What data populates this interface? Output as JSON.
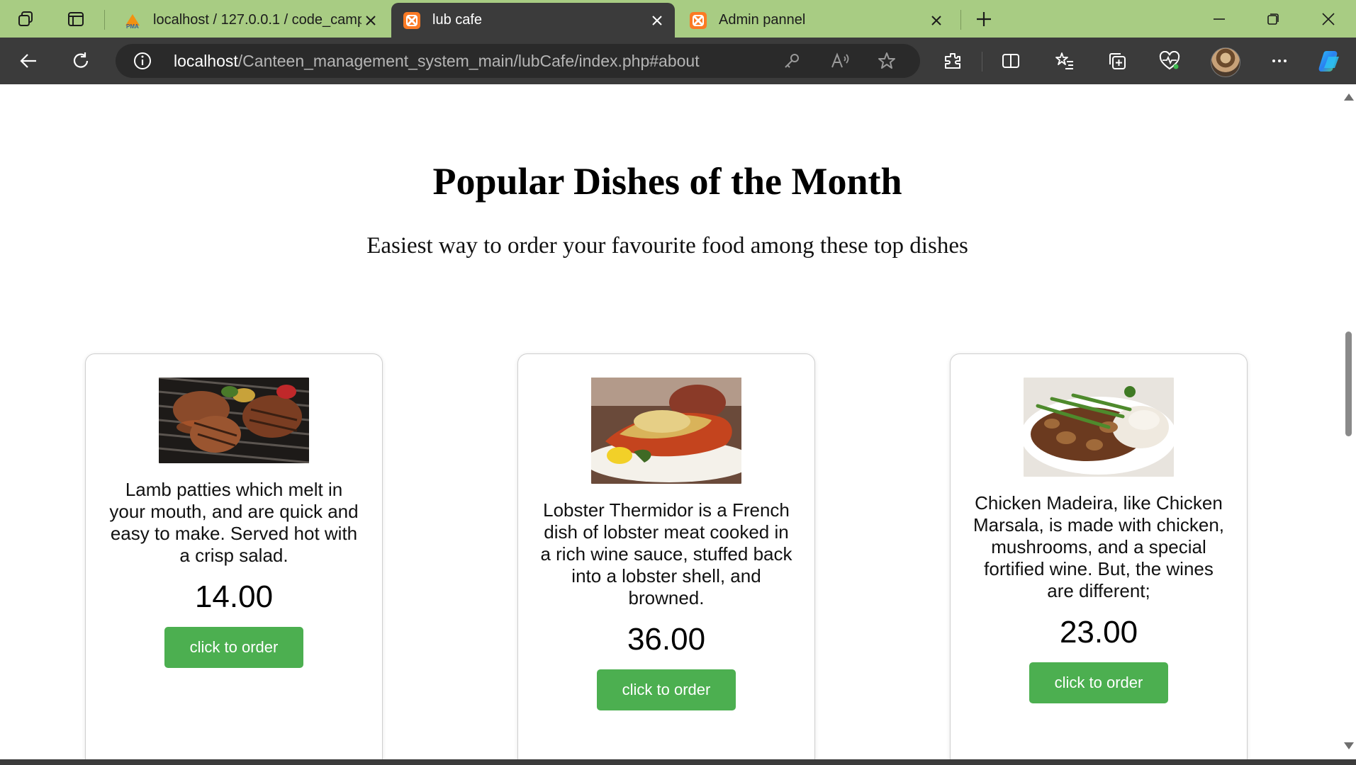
{
  "browser": {
    "tabs": [
      {
        "label": "localhost / 127.0.0.1 / code_camp",
        "favicon": "phpmyadmin-icon",
        "active": false
      },
      {
        "label": "lub cafe",
        "favicon": "xampp-icon",
        "active": true
      },
      {
        "label": "Admin pannel",
        "favicon": "xampp-icon",
        "active": false
      }
    ],
    "address": {
      "host": "localhost",
      "path": "/Canteen_management_system_main/lubCafe/index.php#about"
    },
    "accent_tab_strip": "#a8cc83",
    "toolbar_color": "#3b3b3b"
  },
  "page": {
    "title": "Popular Dishes of the Month",
    "subtitle": "Easiest way to order your favourite food among these top dishes",
    "dishes": [
      {
        "image": "grilled-lamb-patties",
        "description": "Lamb patties which melt in your mouth, and are quick and easy to make. Served hot with a crisp salad.",
        "price": "14.00",
        "button": "click to order"
      },
      {
        "image": "lobster-thermidor",
        "description": "Lobster Thermidor is a French dish of lobster meat cooked in a rich wine sauce, stuffed back into a lobster shell, and browned.",
        "price": "36.00",
        "button": "click to order"
      },
      {
        "image": "chicken-madeira",
        "description": "Chicken Madeira, like Chicken Marsala, is made with chicken, mushrooms, and a special fortified wine. But, the wines are different;",
        "price": "23.00",
        "button": "click to order"
      }
    ],
    "button_color": "#4caf50"
  }
}
